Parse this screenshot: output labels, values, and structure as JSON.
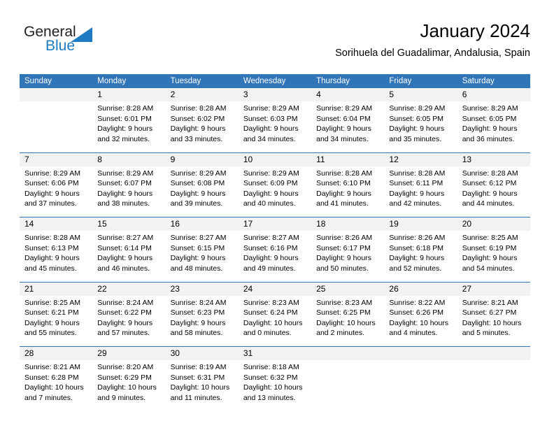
{
  "brand": {
    "name_part1": "General",
    "name_part2": "Blue",
    "triangle_color": "#1f7bc1",
    "text_color": "#231f20"
  },
  "header": {
    "title": "January 2024",
    "subtitle": "Sorihuela del Guadalimar, Andalusia, Spain"
  },
  "theme": {
    "header_blue": "#3075b8",
    "day_band_gray": "#f2f2f2",
    "text_black": "#000000"
  },
  "calendar": {
    "weekday_headers": [
      "Sunday",
      "Monday",
      "Tuesday",
      "Wednesday",
      "Thursday",
      "Friday",
      "Saturday"
    ],
    "weeks": [
      [
        {
          "day": "",
          "sunrise": "",
          "sunset": "",
          "daylight": ""
        },
        {
          "day": "1",
          "sunrise": "Sunrise: 8:28 AM",
          "sunset": "Sunset: 6:01 PM",
          "daylight": "Daylight: 9 hours and 32 minutes."
        },
        {
          "day": "2",
          "sunrise": "Sunrise: 8:28 AM",
          "sunset": "Sunset: 6:02 PM",
          "daylight": "Daylight: 9 hours and 33 minutes."
        },
        {
          "day": "3",
          "sunrise": "Sunrise: 8:29 AM",
          "sunset": "Sunset: 6:03 PM",
          "daylight": "Daylight: 9 hours and 34 minutes."
        },
        {
          "day": "4",
          "sunrise": "Sunrise: 8:29 AM",
          "sunset": "Sunset: 6:04 PM",
          "daylight": "Daylight: 9 hours and 34 minutes."
        },
        {
          "day": "5",
          "sunrise": "Sunrise: 8:29 AM",
          "sunset": "Sunset: 6:05 PM",
          "daylight": "Daylight: 9 hours and 35 minutes."
        },
        {
          "day": "6",
          "sunrise": "Sunrise: 8:29 AM",
          "sunset": "Sunset: 6:05 PM",
          "daylight": "Daylight: 9 hours and 36 minutes."
        }
      ],
      [
        {
          "day": "7",
          "sunrise": "Sunrise: 8:29 AM",
          "sunset": "Sunset: 6:06 PM",
          "daylight": "Daylight: 9 hours and 37 minutes."
        },
        {
          "day": "8",
          "sunrise": "Sunrise: 8:29 AM",
          "sunset": "Sunset: 6:07 PM",
          "daylight": "Daylight: 9 hours and 38 minutes."
        },
        {
          "day": "9",
          "sunrise": "Sunrise: 8:29 AM",
          "sunset": "Sunset: 6:08 PM",
          "daylight": "Daylight: 9 hours and 39 minutes."
        },
        {
          "day": "10",
          "sunrise": "Sunrise: 8:29 AM",
          "sunset": "Sunset: 6:09 PM",
          "daylight": "Daylight: 9 hours and 40 minutes."
        },
        {
          "day": "11",
          "sunrise": "Sunrise: 8:28 AM",
          "sunset": "Sunset: 6:10 PM",
          "daylight": "Daylight: 9 hours and 41 minutes."
        },
        {
          "day": "12",
          "sunrise": "Sunrise: 8:28 AM",
          "sunset": "Sunset: 6:11 PM",
          "daylight": "Daylight: 9 hours and 42 minutes."
        },
        {
          "day": "13",
          "sunrise": "Sunrise: 8:28 AM",
          "sunset": "Sunset: 6:12 PM",
          "daylight": "Daylight: 9 hours and 44 minutes."
        }
      ],
      [
        {
          "day": "14",
          "sunrise": "Sunrise: 8:28 AM",
          "sunset": "Sunset: 6:13 PM",
          "daylight": "Daylight: 9 hours and 45 minutes."
        },
        {
          "day": "15",
          "sunrise": "Sunrise: 8:27 AM",
          "sunset": "Sunset: 6:14 PM",
          "daylight": "Daylight: 9 hours and 46 minutes."
        },
        {
          "day": "16",
          "sunrise": "Sunrise: 8:27 AM",
          "sunset": "Sunset: 6:15 PM",
          "daylight": "Daylight: 9 hours and 48 minutes."
        },
        {
          "day": "17",
          "sunrise": "Sunrise: 8:27 AM",
          "sunset": "Sunset: 6:16 PM",
          "daylight": "Daylight: 9 hours and 49 minutes."
        },
        {
          "day": "18",
          "sunrise": "Sunrise: 8:26 AM",
          "sunset": "Sunset: 6:17 PM",
          "daylight": "Daylight: 9 hours and 50 minutes."
        },
        {
          "day": "19",
          "sunrise": "Sunrise: 8:26 AM",
          "sunset": "Sunset: 6:18 PM",
          "daylight": "Daylight: 9 hours and 52 minutes."
        },
        {
          "day": "20",
          "sunrise": "Sunrise: 8:25 AM",
          "sunset": "Sunset: 6:19 PM",
          "daylight": "Daylight: 9 hours and 54 minutes."
        }
      ],
      [
        {
          "day": "21",
          "sunrise": "Sunrise: 8:25 AM",
          "sunset": "Sunset: 6:21 PM",
          "daylight": "Daylight: 9 hours and 55 minutes."
        },
        {
          "day": "22",
          "sunrise": "Sunrise: 8:24 AM",
          "sunset": "Sunset: 6:22 PM",
          "daylight": "Daylight: 9 hours and 57 minutes."
        },
        {
          "day": "23",
          "sunrise": "Sunrise: 8:24 AM",
          "sunset": "Sunset: 6:23 PM",
          "daylight": "Daylight: 9 hours and 58 minutes."
        },
        {
          "day": "24",
          "sunrise": "Sunrise: 8:23 AM",
          "sunset": "Sunset: 6:24 PM",
          "daylight": "Daylight: 10 hours and 0 minutes."
        },
        {
          "day": "25",
          "sunrise": "Sunrise: 8:23 AM",
          "sunset": "Sunset: 6:25 PM",
          "daylight": "Daylight: 10 hours and 2 minutes."
        },
        {
          "day": "26",
          "sunrise": "Sunrise: 8:22 AM",
          "sunset": "Sunset: 6:26 PM",
          "daylight": "Daylight: 10 hours and 4 minutes."
        },
        {
          "day": "27",
          "sunrise": "Sunrise: 8:21 AM",
          "sunset": "Sunset: 6:27 PM",
          "daylight": "Daylight: 10 hours and 5 minutes."
        }
      ],
      [
        {
          "day": "28",
          "sunrise": "Sunrise: 8:21 AM",
          "sunset": "Sunset: 6:28 PM",
          "daylight": "Daylight: 10 hours and 7 minutes."
        },
        {
          "day": "29",
          "sunrise": "Sunrise: 8:20 AM",
          "sunset": "Sunset: 6:29 PM",
          "daylight": "Daylight: 10 hours and 9 minutes."
        },
        {
          "day": "30",
          "sunrise": "Sunrise: 8:19 AM",
          "sunset": "Sunset: 6:31 PM",
          "daylight": "Daylight: 10 hours and 11 minutes."
        },
        {
          "day": "31",
          "sunrise": "Sunrise: 8:18 AM",
          "sunset": "Sunset: 6:32 PM",
          "daylight": "Daylight: 10 hours and 13 minutes."
        },
        {
          "day": "",
          "sunrise": "",
          "sunset": "",
          "daylight": ""
        },
        {
          "day": "",
          "sunrise": "",
          "sunset": "",
          "daylight": ""
        },
        {
          "day": "",
          "sunrise": "",
          "sunset": "",
          "daylight": ""
        }
      ]
    ]
  }
}
